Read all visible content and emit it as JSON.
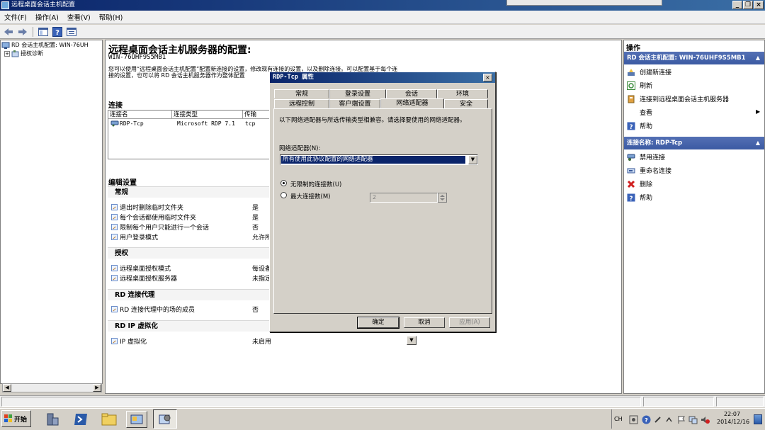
{
  "window": {
    "title": "远程桌面会话主机配置"
  },
  "menu": {
    "items": [
      "文件(F)",
      "操作(A)",
      "查看(V)",
      "帮助(H)"
    ]
  },
  "toolbar": {
    "icons": [
      "back-icon",
      "forward-icon",
      "show-hide-tree-icon",
      "help-icon",
      "properties-icon"
    ]
  },
  "tree": {
    "root": "RD 会话主机配置: WIN-76UH",
    "child": "授权诊断"
  },
  "center": {
    "title": "远程桌面会话主机服务器的配置:",
    "server": "WIN-76UHF9S5MB1",
    "desc_line1": "您可以使用“远程桌面会话主机配置”配置新连接的设置，修改现有连接的设置，以及删除连接。可以配置基于每个连",
    "desc_line2": "接的设置，也可以将 RD 会话主机服务器作为整体配置",
    "connections_heading": "连接",
    "columns": [
      "连接名",
      "连接类型",
      "传输"
    ],
    "rows": [
      {
        "name": "RDP-Tcp",
        "type": "Microsoft RDP 7.1",
        "transport": "tcp"
      }
    ],
    "edit_heading": "编辑设置",
    "sections": [
      {
        "title": "常规",
        "items": [
          {
            "label": "退出时删除临时文件夹",
            "value": "是"
          },
          {
            "label": "每个会话都使用临时文件夹",
            "value": "是"
          },
          {
            "label": "限制每个用户只能进行一个会话",
            "value": "否"
          },
          {
            "label": "用户登录模式",
            "value": "允许所"
          }
        ]
      },
      {
        "title": "授权",
        "items": [
          {
            "label": "远程桌面授权模式",
            "value": "每设备"
          },
          {
            "label": "远程桌面授权服务器",
            "value": "未指定"
          }
        ]
      },
      {
        "title": "RD 连接代理",
        "items": [
          {
            "label": "RD 连接代理中的场的成员",
            "value": "否"
          }
        ]
      },
      {
        "title": "RD IP 虚拟化",
        "items": [
          {
            "label": "IP 虚拟化",
            "value": "未启用"
          }
        ]
      }
    ]
  },
  "dialog": {
    "title": "RDP-Tcp 属性",
    "tabs_row1": [
      "常规",
      "登录设置",
      "会话",
      "环境"
    ],
    "tabs_row2": [
      "远程控制",
      "客户端设置",
      "网络适配器",
      "安全"
    ],
    "active_tab": "网络适配器",
    "description": "以下网络适配器与所选传输类型相兼容。请选择要使用的网络适配器。",
    "adapter_label": "网络适配器(N):",
    "adapter_selected": "所有使用此协议配置的网络适配器",
    "radio_unlimited": "无限制的连接数(U)",
    "radio_max": "最大连接数(M)",
    "radio_selected": "unlimited",
    "max_value": "2",
    "ok": "确定",
    "cancel": "取消",
    "apply": "应用(A)"
  },
  "actions": {
    "title": "操作",
    "group1": {
      "header": "RD 会话主机配置: WIN-76UHF9S5MB1",
      "items": [
        {
          "label": "创建新连接",
          "icon": "new-connection-icon"
        },
        {
          "label": "刷新",
          "icon": "refresh-icon"
        },
        {
          "label": "连接到远程桌面会话主机服务器",
          "icon": "connect-server-icon"
        },
        {
          "label": "查看",
          "icon": "none"
        },
        {
          "label": "帮助",
          "icon": "help-icon"
        }
      ]
    },
    "group2": {
      "header": "连接名称: RDP-Tcp",
      "items": [
        {
          "label": "禁用连接",
          "icon": "disable-connection-icon"
        },
        {
          "label": "重命名连接",
          "icon": "rename-icon"
        },
        {
          "label": "删除",
          "icon": "delete-icon"
        },
        {
          "label": "帮助",
          "icon": "help-icon"
        }
      ]
    }
  },
  "taskbar": {
    "start": "开始",
    "lang": "CH",
    "time": "22:07",
    "date": "2014/12/16"
  },
  "colors": {
    "title_bar": "#0a246a",
    "action_header": "#4664ac",
    "selection": "#0a246a"
  }
}
